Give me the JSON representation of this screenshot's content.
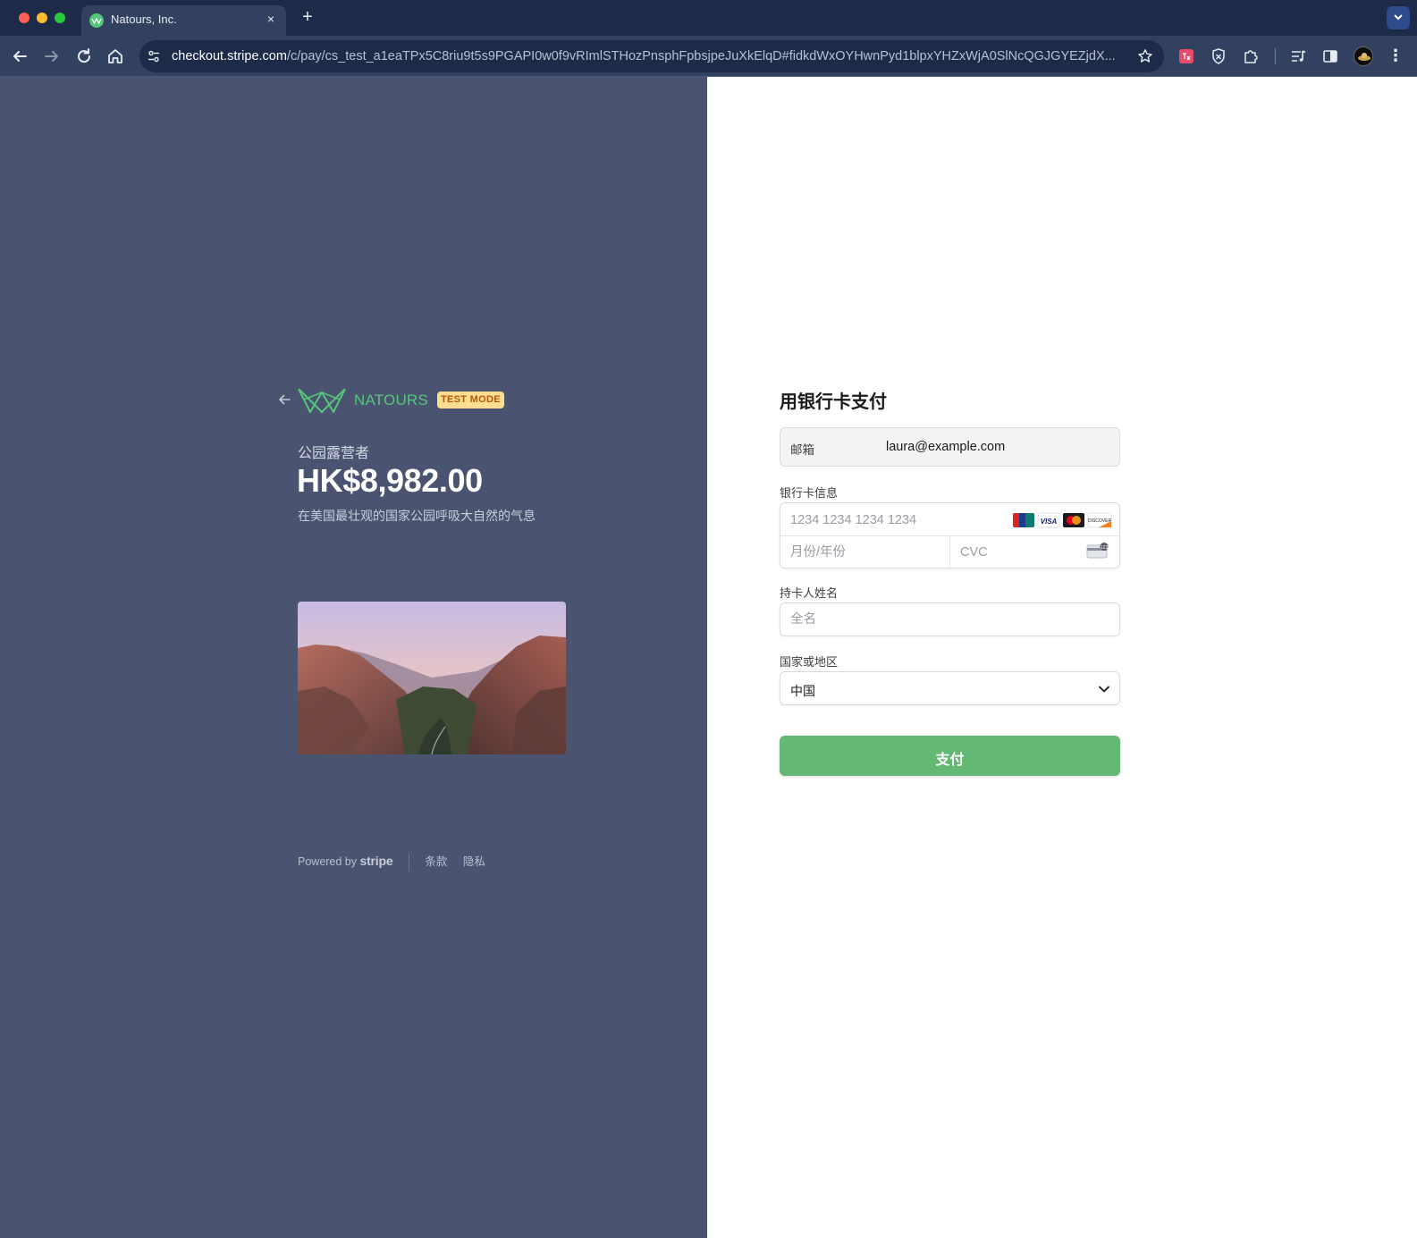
{
  "browser": {
    "tab_title": "Natours, Inc.",
    "tab_close_label": "×",
    "new_tab_label": "+",
    "url_host": "checkout.stripe.com",
    "url_rest": "/c/pay/cs_test_a1eaTPx5C8riu9t5s9PGAPI0w0f9vRImlSTHozPnsphFpbsjpeJuXkElqD#fidkdWxOYHwnPyd1blpxYHZxWjA0SlNcQGJGYEZjdX...",
    "menu_label": "⋮",
    "icons": {
      "back": "back-arrow-icon",
      "forward": "forward-arrow-icon",
      "reload": "reload-icon",
      "home": "home-icon",
      "site_settings": "tune-icon",
      "bookmark": "star-icon",
      "extensions": "puzzle-icon"
    }
  },
  "checkout": {
    "brand_name": "NATOURS",
    "test_badge": "TEST MODE",
    "product_name": "公园露营者",
    "price": "HK$8,982.00",
    "description": "在美国最壮观的国家公园呼吸大自然的气息",
    "footer": {
      "powered_by": "Powered by",
      "stripe": "stripe",
      "terms": "条款",
      "privacy": "隐私"
    },
    "colors": {
      "left_panel": "#4a5471",
      "brand_green": "#55c57a",
      "pay_button": "#63b874",
      "badge_bg": "#ffde92",
      "badge_text": "#bb5504"
    }
  },
  "form": {
    "title": "用银行卡支付",
    "email_label": "邮箱",
    "email_value": "laura@example.com",
    "card_label": "银行卡信息",
    "card_number_placeholder": "1234 1234 1234 1234",
    "expiry_placeholder": "月份/年份",
    "cvc_placeholder": "CVC",
    "card_brands": [
      "UnionPay",
      "VISA",
      "Mastercard",
      "DISCOVER"
    ],
    "name_label": "持卡人姓名",
    "name_placeholder": "全名",
    "country_label": "国家或地区",
    "country_value": "中国",
    "pay_label": "支付"
  }
}
